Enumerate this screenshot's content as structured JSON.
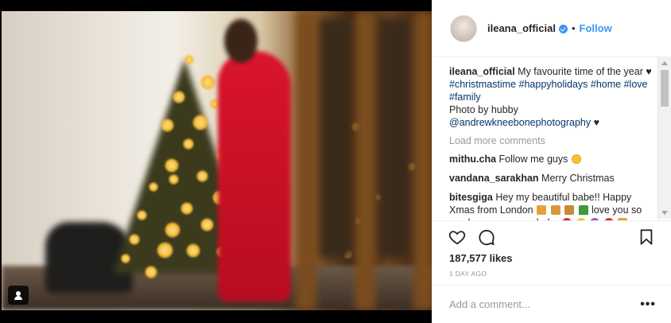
{
  "post": {
    "author": "ileana_official",
    "verified": true,
    "follow_label": "Follow",
    "separator": "•",
    "caption_author": "ileana_official",
    "caption_text": "My favourite time of the year ♥",
    "caption_tags": [
      "#christmastime",
      "#happyholidays",
      "#home",
      "#love",
      "#family"
    ],
    "caption_credit": "Photo by hubby",
    "caption_mention": "@andrewkneebonephotography",
    "caption_end": "♥"
  },
  "comments": {
    "load_more": "Load more comments",
    "items": [
      {
        "user": "mithu.cha",
        "text": "Follow me guys"
      },
      {
        "user": "vandana_sarakhan",
        "text": "Merry Christmas"
      },
      {
        "user": "bitesgiga",
        "text": "Hey my beautiful babe!! Happy Xmas from London",
        "text2": "love you so much my gorgeous babe"
      }
    ]
  },
  "stats": {
    "likes": "187,577 likes",
    "time_ago": "1 DAY AGO"
  },
  "add_comment": {
    "placeholder": "Add a comment..."
  },
  "icons": {
    "like": "heart-icon",
    "comment": "speech-bubble-icon",
    "save": "bookmark-icon",
    "tagged": "person-tag-icon",
    "options": "ellipsis-icon"
  },
  "colors": {
    "link": "#003569",
    "follow": "#3897f0",
    "muted": "#999999",
    "dress": "#d9142b"
  }
}
